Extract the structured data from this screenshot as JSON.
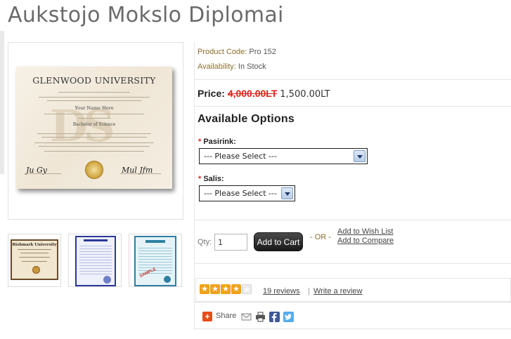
{
  "page": {
    "title": "Aukstojo Mokslo Diplomai"
  },
  "main_image": {
    "university": "GLENWOOD UNIVERSITY",
    "name": "Your Name Here",
    "degree": "Bachelor of Science",
    "watermark": "DS"
  },
  "thumbnails": [
    {
      "title": "Bishmark University"
    },
    {
      "title": ""
    },
    {
      "title": "",
      "stamp": "SAMPLE"
    }
  ],
  "product": {
    "code_label": "Product Code:",
    "code_value": "Pro 152",
    "availability_label": "Availability:",
    "availability_value": "In Stock",
    "price_label": "Price:",
    "price_old": "4,000.00LT",
    "price_new": "1,500.00LT"
  },
  "options": {
    "title": "Available Options",
    "fields": [
      {
        "required_mark": "*",
        "label": "Pasirink:",
        "selected": "--- Please Select ---"
      },
      {
        "required_mark": "*",
        "label": "Salis:",
        "selected": "--- Please Select ---"
      }
    ]
  },
  "cart": {
    "qty_label": "Qty:",
    "qty_value": "1",
    "add_button": "Add to Cart",
    "or_text": "- OR -",
    "wishlist_link": "Add to Wish List",
    "compare_link": "Add to Compare"
  },
  "review": {
    "rating": 4,
    "max_rating": 5,
    "reviews_link": "19 reviews",
    "separator": "|",
    "write_link": "Write a review"
  },
  "share": {
    "label": "Share"
  },
  "colors": {
    "accent_gold": "#8b6f2e",
    "price_old": "#e0221a",
    "star": "#f0a21a"
  }
}
